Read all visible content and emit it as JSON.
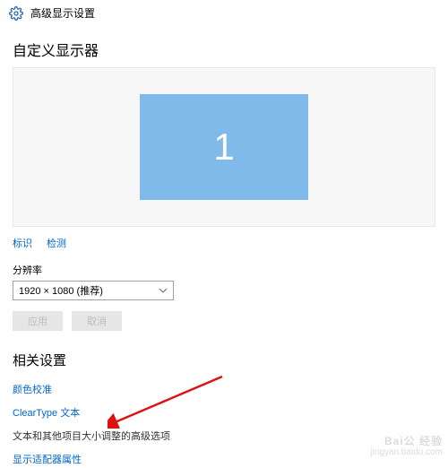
{
  "header": {
    "title": "高级显示设置"
  },
  "customize": {
    "title": "自定义显示器"
  },
  "monitor": {
    "number": "1"
  },
  "actions": {
    "identify": "标识",
    "detect": "检测"
  },
  "resolution": {
    "label": "分辨率",
    "selected": "1920 × 1080 (推荐)"
  },
  "buttons": {
    "apply": "应用",
    "cancel": "取消"
  },
  "related": {
    "title": "相关设置",
    "color_calibration": "颜色校准",
    "cleartype": "ClearType 文本",
    "text_sizing": "文本和其他项目大小调整的高级选项",
    "adapter": "显示适配器属性"
  },
  "watermark": {
    "line1": "Bai公 经验",
    "line2": "jingyan.baidu.com"
  }
}
